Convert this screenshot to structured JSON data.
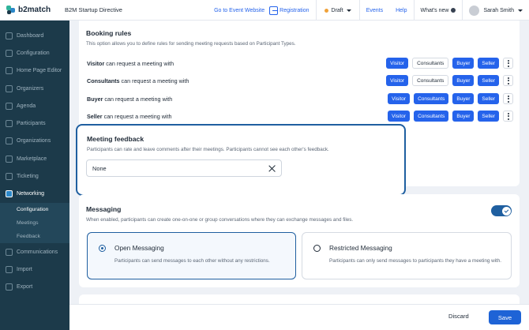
{
  "header": {
    "logo_text": "b2match",
    "event_name": "B2M Startup Directive",
    "go_to_event": "Go to Event Website",
    "registration": "Registration",
    "status": "Draft",
    "events": "Events",
    "help": "Help",
    "whats_new": "What's new",
    "user_name": "Sarah Smith"
  },
  "sidebar": {
    "items": [
      {
        "label": "Dashboard",
        "icon": "dashboard-icon"
      },
      {
        "label": "Configuration",
        "icon": "gear-icon"
      },
      {
        "label": "Home Page Editor",
        "icon": "home-icon"
      },
      {
        "label": "Organizers",
        "icon": "organizers-icon"
      },
      {
        "label": "Agenda",
        "icon": "calendar-icon"
      },
      {
        "label": "Participants",
        "icon": "participants-icon"
      },
      {
        "label": "Organizations",
        "icon": "building-icon"
      },
      {
        "label": "Marketplace",
        "icon": "marketplace-icon"
      },
      {
        "label": "Ticketing",
        "icon": "ticket-icon"
      },
      {
        "label": "Networking",
        "icon": "networking-icon"
      }
    ],
    "sub_items": [
      "Configuration",
      "Meetings",
      "Feedback"
    ],
    "bottom_items": [
      {
        "label": "Communications",
        "icon": "communications-icon"
      },
      {
        "label": "Import",
        "icon": "import-icon"
      },
      {
        "label": "Export",
        "icon": "export-icon"
      }
    ]
  },
  "booking": {
    "title": "Booking rules",
    "description": "This option allows you to define rules for sending meeting requests based on Participant Types.",
    "suffix": "can request a meeting with",
    "types": [
      "Visitor",
      "Consultants",
      "Buyer",
      "Seller"
    ],
    "rows": [
      {
        "type": "Visitor",
        "allowed": [
          true,
          false,
          true,
          true
        ]
      },
      {
        "type": "Consultants",
        "allowed": [
          true,
          false,
          true,
          true
        ]
      },
      {
        "type": "Buyer",
        "allowed": [
          true,
          true,
          true,
          true
        ]
      },
      {
        "type": "Seller",
        "allowed": [
          true,
          true,
          true,
          true
        ]
      }
    ]
  },
  "feedback": {
    "title": "Meeting feedback",
    "description": "Participants can rate and leave comments after their meetings. Participants cannot see each other's feedback.",
    "value": "None"
  },
  "messaging": {
    "title": "Messaging",
    "description": "When enabled, participants can create one-on-one or group conversations where they can exchange messages and files.",
    "enabled": true,
    "options": [
      {
        "title": "Open Messaging",
        "description": "Participants can send messages to each other without any restrictions.",
        "selected": true
      },
      {
        "title": "Restricted Messaging",
        "description": "Participants can only send messages to participants they have a meeting with.",
        "selected": false
      }
    ]
  },
  "actions": {
    "discard": "Discard",
    "save": "Save"
  }
}
